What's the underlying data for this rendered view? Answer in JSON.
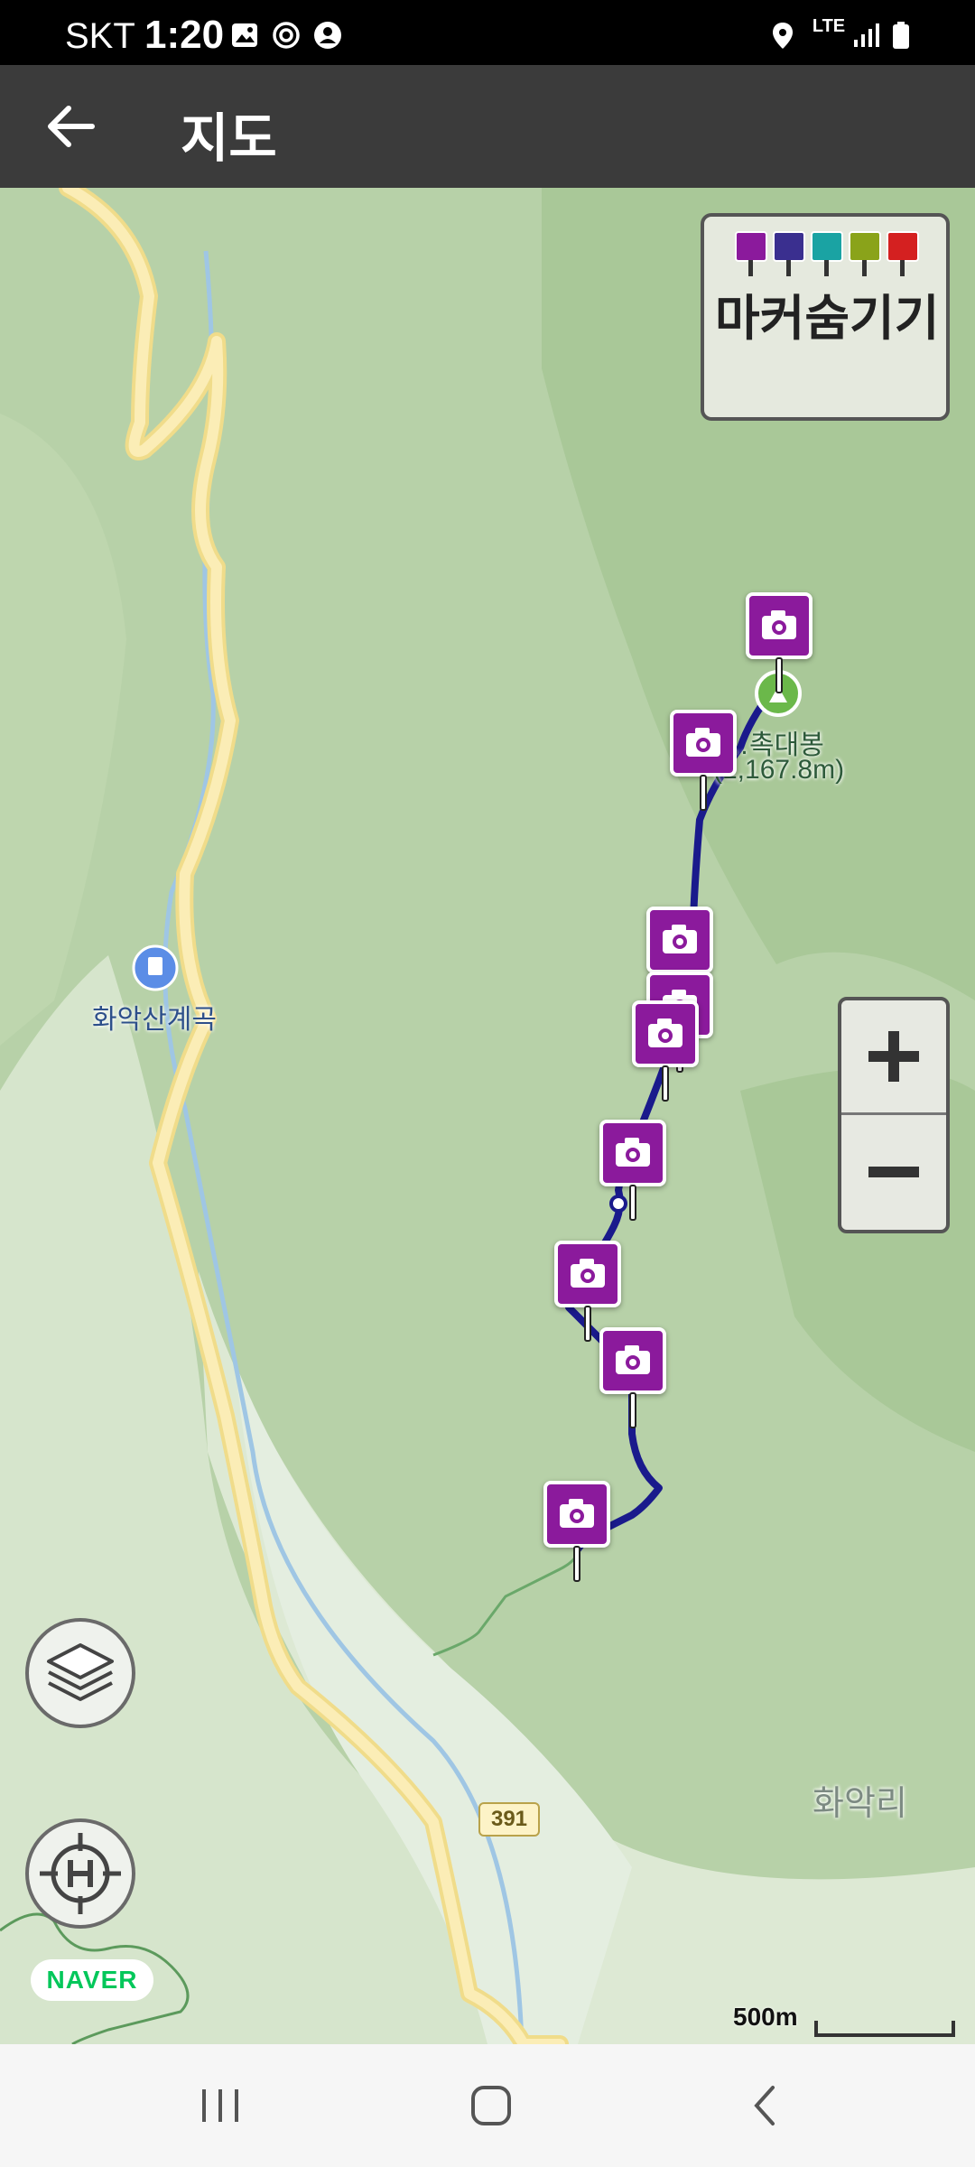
{
  "status_bar": {
    "carrier": "SKT",
    "time": "1:20",
    "network": "LTE",
    "icons": [
      "gallery-icon",
      "sync-icon",
      "account-icon",
      "location-icon",
      "lte-icon",
      "signal-icon",
      "battery-icon"
    ]
  },
  "app_bar": {
    "back_icon": "arrow-left-icon",
    "title": "지도"
  },
  "map": {
    "marker_panel": {
      "label": "마커숨기기",
      "flags": [
        {
          "icon": "camera-icon",
          "color": "#8b1a9c"
        },
        {
          "icon": "video-icon",
          "color": "#3a2f8f"
        },
        {
          "icon": "pen-icon",
          "color": "#1aa3a3"
        },
        {
          "icon": "note-icon",
          "color": "#8aa31a"
        },
        {
          "icon": "flag-icon",
          "color": "#d42020"
        }
      ]
    },
    "peak_label_line1": "…촉대봉",
    "peak_label_line2": "(1,167.8m)",
    "valley_label": "화악산계곡",
    "village_label": "화악리",
    "road_number": "391",
    "zoom_in_icon": "plus-icon",
    "zoom_out_icon": "minus-icon",
    "layers_icon": "layers-icon",
    "home_location_icon": "home-target-icon",
    "provider_logo": "NAVER",
    "scale_label": "500m",
    "photo_marker_icon": "camera-icon",
    "photo_marker_color": "#8b1a9c",
    "track_color": "#1a1a8c"
  },
  "nav_bar": {
    "recent_icon": "recent-apps-icon",
    "home_icon": "home-icon",
    "back_icon": "back-icon"
  }
}
